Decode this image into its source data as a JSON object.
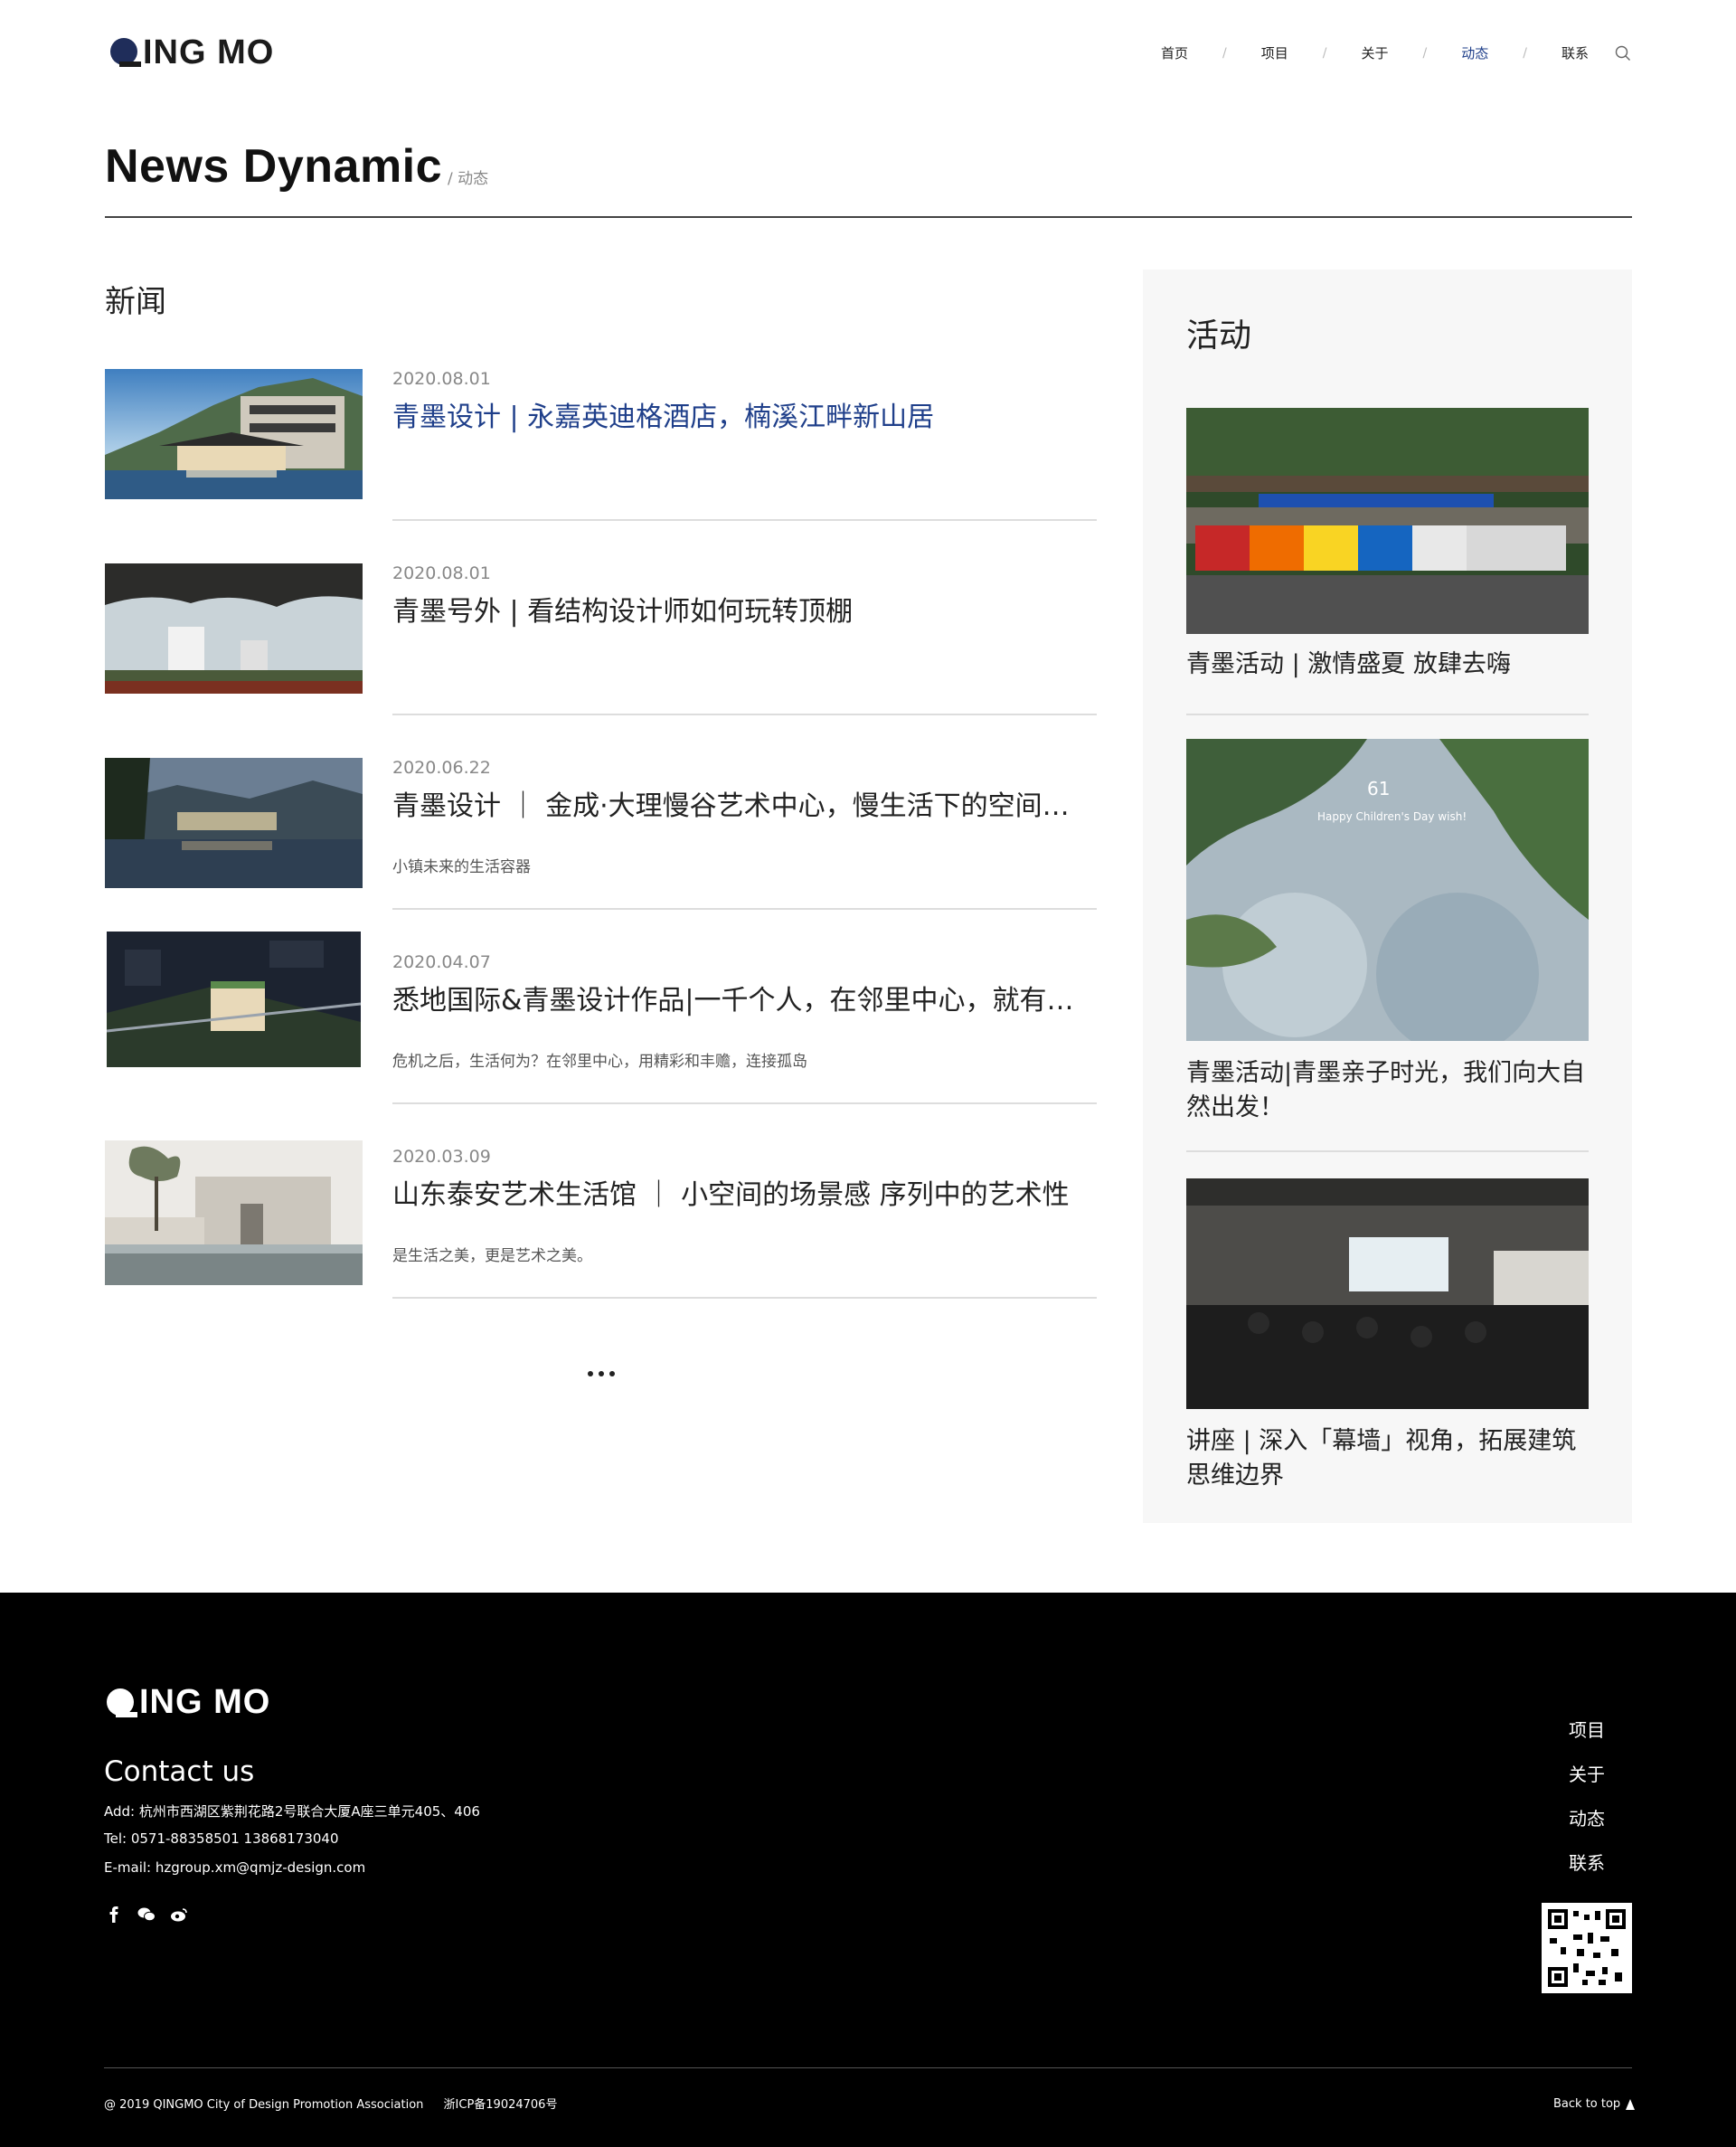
{
  "header": {
    "logo_text": "ING MO",
    "nav": [
      "首页",
      "项目",
      "关于",
      "动态",
      "联系"
    ],
    "nav_separator": "/",
    "active_nav": "动态",
    "accent_color": "#1f3f8a"
  },
  "page": {
    "title": "News Dynamic",
    "subtitle": "/ 动态"
  },
  "news": {
    "heading": "新闻",
    "items": [
      {
        "date": "2020.08.01",
        "title": "青墨设计 | 永嘉英迪格酒店，楠溪江畔新山居",
        "desc": "",
        "thumb": "hotel-building-image"
      },
      {
        "date": "2020.08.01",
        "title": "青墨号外 | 看结构设计师如何玩转顶棚",
        "desc": "",
        "thumb": "canopy-structure-image"
      },
      {
        "date": "2020.06.22",
        "title": "青墨设计 ｜ 金成·大理慢谷艺术中心，慢生活下的空间…",
        "desc": "小镇未来的生活容器",
        "thumb": "lakeside-art-center-image"
      },
      {
        "date": "2020.04.07",
        "title": "悉地国际&青墨设计作品|一千个人，在邻里中心，就有…",
        "desc": "危机之后，生活何为？在邻里中心，用精彩和丰赡，连接孤岛",
        "thumb": "neighborhood-center-aerial-image"
      },
      {
        "date": "2020.03.09",
        "title": "山东泰安艺术生活馆 ｜ 小空间的场景感 序列中的艺术性",
        "desc": "是生活之美，更是艺术之美。",
        "thumb": "art-pavilion-image"
      }
    ],
    "more_icon": "more-dots-icon"
  },
  "activity": {
    "heading": "活动",
    "items": [
      {
        "title": "青墨活动 | 激情盛夏 放肆去嗨",
        "image": "team-group-photo-image"
      },
      {
        "title": "青墨活动|青墨亲子时光，我们向大自然出发！",
        "image": "childrens-day-leaves-image"
      },
      {
        "title": "讲座 | 深入「幕墙」视角，拓展建筑思维边界",
        "image": "lecture-room-image"
      }
    ]
  },
  "footer": {
    "logo_text": "ING MO",
    "contact_heading": "Contact us",
    "address": "Add:  杭州市西湖区紫荆花路2号联合大厦A座三单元405、406",
    "tel": "Tel:  0571-88358501 13868173040",
    "email": "E-mail:  hzgroup.xm@qmjz-design.com",
    "social_icons": [
      "facebook-icon",
      "wechat-icon",
      "weibo-icon"
    ],
    "nav": [
      "项目",
      "关于",
      "动态",
      "联系"
    ],
    "copyright": "@ 2019 QINGMO City of Design Promotion Association",
    "icp": "浙ICP备19024706号",
    "back_to_top": "Back to top"
  }
}
